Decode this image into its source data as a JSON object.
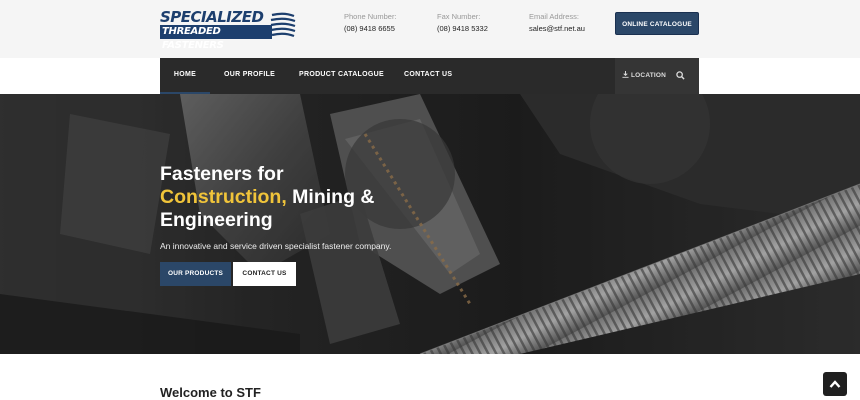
{
  "header": {
    "logo": {
      "line1": "SPECIALIZED",
      "line2": "THREADED FASTENERS"
    },
    "phone": {
      "label": "Phone Number:",
      "value": "(08) 9418 6655"
    },
    "fax": {
      "label": "Fax Number:",
      "value": "(08) 9418 5332"
    },
    "email": {
      "label": "Email Address:",
      "value": "sales@stf.net.au"
    },
    "online_catalogue": "ONLINE CATALOGUE"
  },
  "nav": {
    "items": [
      {
        "label": "HOME",
        "active": true
      },
      {
        "label": "OUR PROFILE"
      },
      {
        "label": "PRODUCT CATALOGUE"
      },
      {
        "label": "CONTACT US"
      }
    ],
    "location": "LOCATION",
    "location_icon": "download-icon",
    "search_icon": "search-icon"
  },
  "hero": {
    "title_line1": "Fasteners for",
    "title_accent": "Construction,",
    "title_line2_rest": " Mining &",
    "title_line3": "Engineering",
    "subtitle": "An innovative and service driven specialist fastener company.",
    "primary_button": "OUR PRODUCTS",
    "secondary_button": "CONTACT US"
  },
  "welcome": {
    "heading": "Welcome to STF"
  },
  "scroll_top_icon": "chevron-up-icon",
  "colors": {
    "brand_navy": "#2b4768",
    "accent_yellow": "#f0c43a",
    "nav_bg": "#2a2a2a"
  }
}
